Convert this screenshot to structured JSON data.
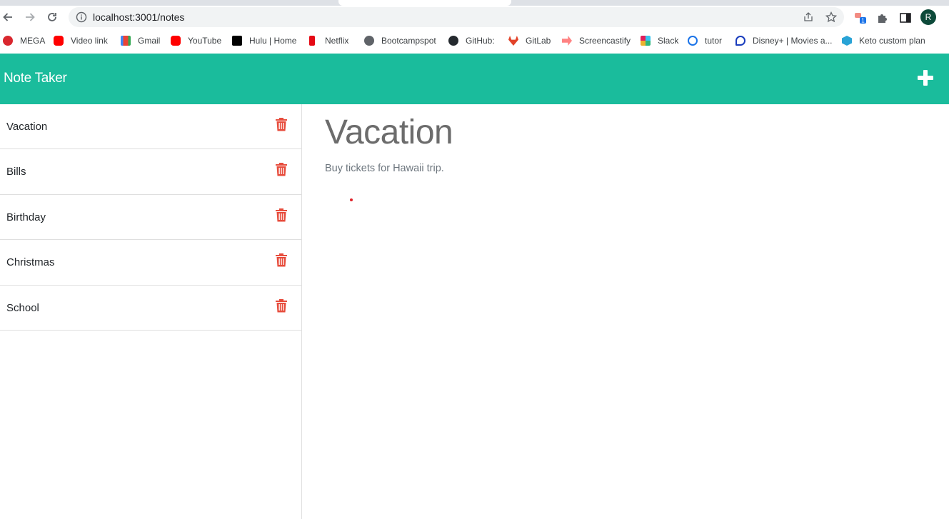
{
  "browser": {
    "url": "localhost:3001/notes",
    "avatar_initial": "R",
    "extension_badge": "1",
    "bookmarks": [
      {
        "label": "MEGA",
        "icon": "mega-icon",
        "color": "#d9272e"
      },
      {
        "label": "Video link",
        "icon": "youtube-icon",
        "color": "#ff0000"
      },
      {
        "label": "Gmail",
        "icon": "gmail-icon",
        "color": "#ea4335"
      },
      {
        "label": "YouTube",
        "icon": "youtube-icon",
        "color": "#ff0000"
      },
      {
        "label": "Hulu | Home",
        "icon": "hulu-icon",
        "color": "#000000"
      },
      {
        "label": "Netflix",
        "icon": "netflix-icon",
        "color": "#e50914"
      },
      {
        "label": "Bootcampspot",
        "icon": "globe-icon",
        "color": "#5f6368"
      },
      {
        "label": "GitHub:",
        "icon": "github-icon",
        "color": "#24292e"
      },
      {
        "label": "GitLab",
        "icon": "gitlab-icon",
        "color": "#e24329"
      },
      {
        "label": "Screencastify",
        "icon": "screencastify-icon",
        "color": "#ff8282"
      },
      {
        "label": "Slack",
        "icon": "slack-icon",
        "color": "#4a154b"
      },
      {
        "label": "tutor",
        "icon": "tutor-icon",
        "color": "#1a73e8"
      },
      {
        "label": "Disney+ | Movies a...",
        "icon": "disney-icon",
        "color": "#1a3dbd"
      },
      {
        "label": "Keto custom plan",
        "icon": "keto-icon",
        "color": "#29a3d6"
      }
    ]
  },
  "app": {
    "brand": "Note Taker",
    "accent_color": "#1abc9c",
    "delete_color": "#e74c3c",
    "notes": [
      {
        "title": "Vacation"
      },
      {
        "title": "Bills"
      },
      {
        "title": "Birthday"
      },
      {
        "title": "Christmas"
      },
      {
        "title": "School"
      }
    ],
    "active_note": {
      "title": "Vacation",
      "text": "Buy tickets for Hawaii trip."
    }
  }
}
